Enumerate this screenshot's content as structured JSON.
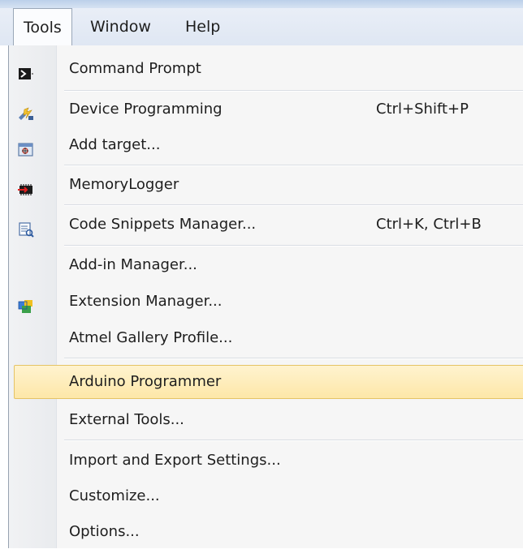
{
  "menubar": {
    "items": [
      "Tools",
      "Window",
      "Help"
    ]
  },
  "menu": {
    "items": [
      {
        "label": "Command Prompt",
        "shortcut": "",
        "icon": "command-prompt-icon"
      },
      {
        "label": "Device Programming",
        "shortcut": "Ctrl+Shift+P",
        "icon": "device-programming-icon"
      },
      {
        "label": "Add target...",
        "shortcut": "",
        "icon": "add-target-icon"
      },
      {
        "label": "MemoryLogger",
        "shortcut": "",
        "icon": "memory-logger-icon"
      },
      {
        "label": "Code Snippets Manager...",
        "shortcut": "Ctrl+K, Ctrl+B",
        "icon": "code-snippets-icon"
      },
      {
        "label": "Add-in Manager...",
        "shortcut": ""
      },
      {
        "label": "Extension Manager...",
        "shortcut": "",
        "icon": "extension-manager-icon"
      },
      {
        "label": "Atmel Gallery Profile...",
        "shortcut": ""
      },
      {
        "label": "Arduino Programmer",
        "shortcut": "",
        "highlighted": true
      },
      {
        "label": "External Tools...",
        "shortcut": ""
      },
      {
        "label": "Import and Export Settings...",
        "shortcut": ""
      },
      {
        "label": "Customize...",
        "shortcut": ""
      },
      {
        "label": "Options...",
        "shortcut": ""
      }
    ]
  },
  "colors": {
    "highlight_bg": "#fde7a8",
    "highlight_border": "#e5c365",
    "menubar_bg": "#dfe7f3"
  }
}
